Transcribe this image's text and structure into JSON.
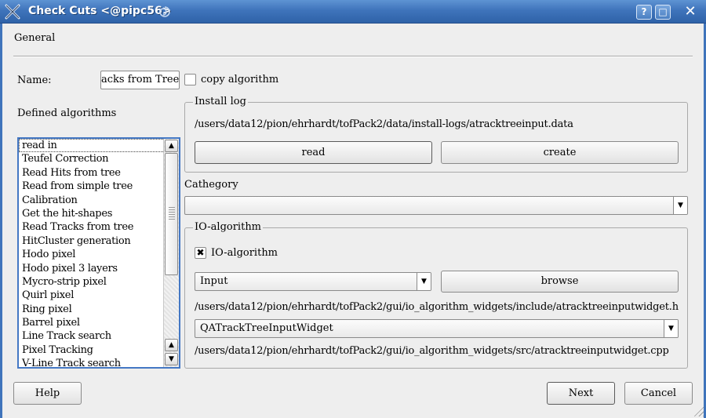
{
  "window": {
    "title": "Check Cuts <@pipc56>",
    "help_btn": "?",
    "maximize_btn": "□",
    "close_btn": "✕"
  },
  "section_title": "General",
  "name": {
    "label": "Name:",
    "value": "acks from Tree",
    "copy_label": "copy algorithm",
    "copy_checked": false
  },
  "algorithms": {
    "label": "Defined algorithms",
    "items": [
      "read in",
      "Teufel Correction",
      "Read Hits from tree",
      "Read from simple tree",
      "Calibration",
      "Get the hit-shapes",
      "Read Tracks from tree",
      "HitCluster generation",
      "Hodo pixel",
      "Hodo pixel 3 layers",
      "Mycro-strip pixel",
      "Quirl pixel",
      "Ring pixel",
      "Barrel pixel",
      "Line Track search",
      "Pixel Tracking",
      "V-Line Track search"
    ]
  },
  "install_log": {
    "title": "Install log",
    "path": "/users/data12/pion/ehrhardt/tofPack2/data/install-logs/atracktreeinput.data",
    "read_label": "read",
    "create_label": "create"
  },
  "category": {
    "label": "Cathegory",
    "value": ""
  },
  "io": {
    "title": "IO-algorithm",
    "checkbox_label": "IO-algorithm",
    "checkbox_mark": "✖",
    "type_value": "Input",
    "browse_label": "browse",
    "header_path": "/users/data12/pion/ehrhardt/tofPack2/gui/io_algorithm_widgets/include/atracktreeinputwidget.h",
    "widget_value": "QATrackTreeInputWidget",
    "source_path": "/users/data12/pion/ehrhardt/tofPack2/gui/io_algorithm_widgets/src/atracktreeinputwidget.cpp"
  },
  "footer": {
    "help_label": "Help",
    "next_label": "Next",
    "cancel_label": "Cancel"
  },
  "icons": {
    "dropdown": "▼",
    "scroll_up": "▲",
    "scroll_down": "▼"
  },
  "colors": {
    "titlebar": "#3f74bb",
    "list_border": "#4478c4",
    "background": "#eeeeee"
  }
}
